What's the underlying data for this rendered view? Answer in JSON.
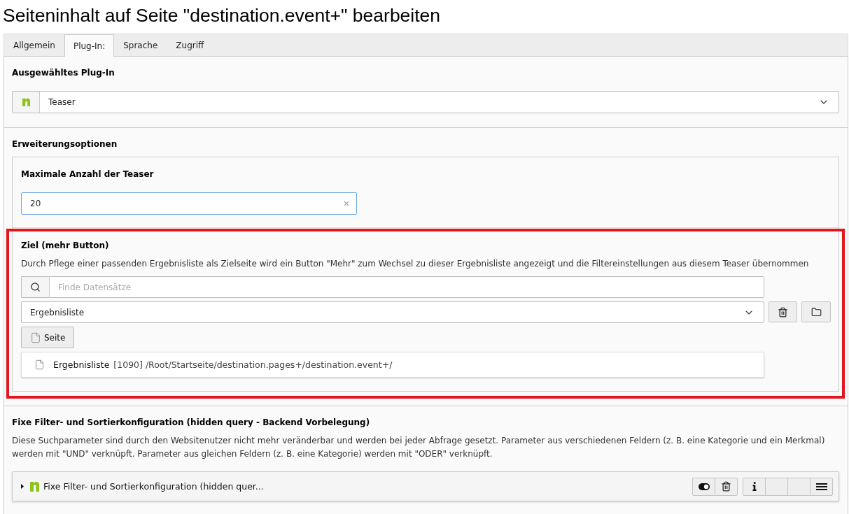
{
  "page_title": "Seiteninhalt auf Seite \"destination.event+\" bearbeiten",
  "tabs": [
    {
      "label": "Allgemein",
      "selected": false
    },
    {
      "label": "Plug-In:",
      "selected": true
    },
    {
      "label": "Sprache",
      "selected": false
    },
    {
      "label": "Zugriff",
      "selected": false
    }
  ],
  "plugin_section": {
    "heading": "Ausgewähltes Plug-In",
    "select": {
      "value": "Teaser"
    }
  },
  "extension_section": {
    "heading": "Erweiterungsoptionen",
    "max_teasers": {
      "label": "Maximale Anzahl der Teaser",
      "value": "20",
      "focused": true
    },
    "target": {
      "highlighted": true,
      "label": "Ziel (mehr Button)",
      "description": "Durch Pflege einer passenden Ergebnisliste als Zielseite wird ein Button \"Mehr\" zum Wechsel zu dieser Ergebnisliste angezeigt und die Filtereinstellungen aus diesem Teaser übernommen",
      "search": {
        "placeholder": "Finde Datensätze"
      },
      "select": {
        "value": "Ergebnisliste"
      },
      "page_button": "Seite",
      "record": {
        "title": "Ergebnisliste",
        "path": "[1090] /Root/Startseite/destination.pages+/destination.event+/"
      }
    }
  },
  "hidden_query_section": {
    "heading": "Fixe Filter- und Sortierkonfiguration (hidden query - Backend Vorbelegung)",
    "description": "Diese Suchparameter sind durch den Websitenutzer nicht mehr veränderbar und werden bei jeder Abfrage gesetzt. Parameter aus verschiedenen Feldern (z. B. eine Kategorie und ein Merkmal) werden mit \"UND\" verknüpft. Parameter aus gleichen Feldern (z. B. eine Kategorie) werden mit \"ODER\" verknüpft.",
    "item": {
      "title": "Fixe Filter- und Sortierkonfiguration (hidden quer...",
      "expanded": false
    }
  }
}
